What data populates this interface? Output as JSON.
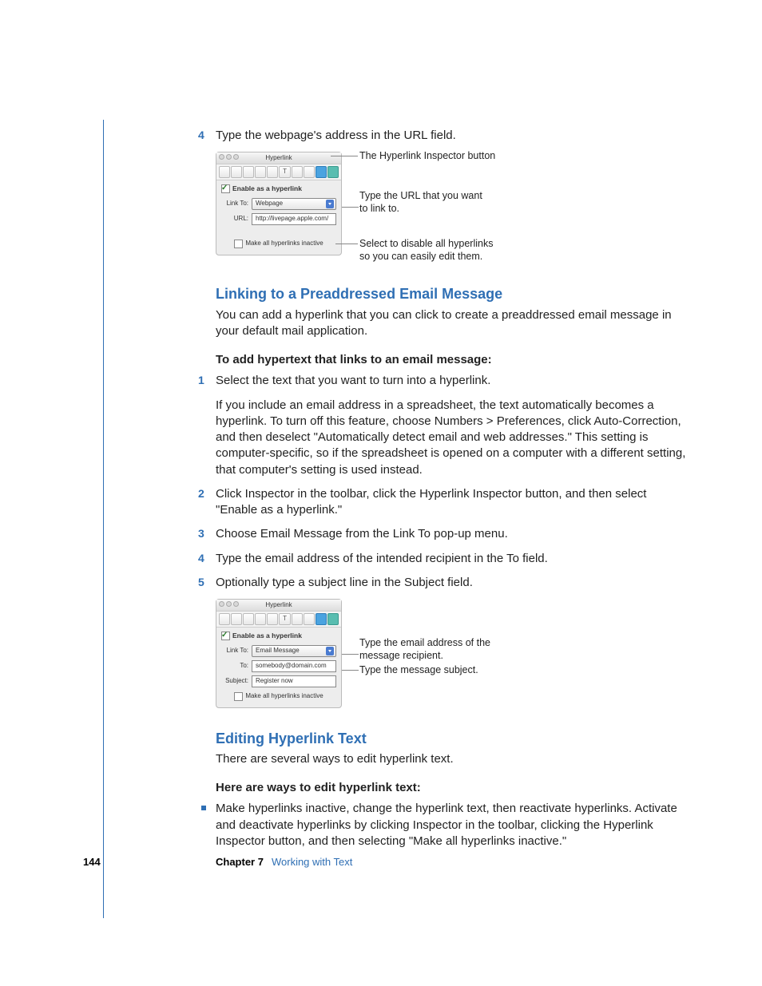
{
  "step4": {
    "num": "4",
    "text": "Type the webpage's address in the URL field."
  },
  "fig1": {
    "title": "Hyperlink",
    "enable": "Enable as a hyperlink",
    "linkto_label": "Link To:",
    "linkto_value": "Webpage",
    "url_label": "URL:",
    "url_value": "http://livepage.apple.com/",
    "inactive": "Make all hyperlinks inactive",
    "c1": "The Hyperlink Inspector button",
    "c2a": "Type the URL that you want",
    "c2b": "to link to.",
    "c3a": "Select to disable all hyperlinks",
    "c3b": "so you can easily edit them."
  },
  "sec1": {
    "heading": "Linking to a Preaddressed Email Message",
    "intro": "You can add a hyperlink that you can click to create a preaddressed email message in your default mail application.",
    "boldline": "To add hypertext that links to an email message:",
    "s1n": "1",
    "s1": "Select the text that you want to turn into a hyperlink.",
    "s1b": "If you include an email address in a spreadsheet, the text automatically becomes a hyperlink. To turn off this feature, choose Numbers > Preferences, click Auto-Correction, and then deselect \"Automatically detect email and web addresses.\" This setting is computer-specific, so if the spreadsheet is opened on a computer with a different setting, that computer's setting is used instead.",
    "s2n": "2",
    "s2": "Click Inspector in the toolbar, click the Hyperlink Inspector button, and then select \"Enable as a hyperlink.\"",
    "s3n": "3",
    "s3": "Choose Email Message from the Link To pop-up menu.",
    "s4n": "4",
    "s4": "Type the email address of the intended recipient in the To field.",
    "s5n": "5",
    "s5": "Optionally type a subject line in the Subject field."
  },
  "fig2": {
    "title": "Hyperlink",
    "enable": "Enable as a hyperlink",
    "linkto_label": "Link To:",
    "linkto_value": "Email Message",
    "to_label": "To:",
    "to_value": "somebody@domain.com",
    "subject_label": "Subject:",
    "subject_value": "Register now",
    "inactive": "Make all hyperlinks inactive",
    "c1a": "Type the email address of the",
    "c1b": "message recipient.",
    "c2": "Type the message subject."
  },
  "sec2": {
    "heading": "Editing Hyperlink Text",
    "intro": "There are several ways to edit hyperlink text.",
    "boldline": "Here are ways to edit hyperlink text:",
    "b1": "Make hyperlinks inactive, change the hyperlink text, then reactivate hyperlinks. Activate and deactivate hyperlinks by clicking Inspector in the toolbar, clicking the Hyperlink Inspector button, and then selecting \"Make all hyperlinks inactive.\""
  },
  "footer": {
    "page": "144",
    "chapter": "Chapter 7",
    "name": "Working with Text"
  },
  "icons": {
    "T": "T"
  }
}
